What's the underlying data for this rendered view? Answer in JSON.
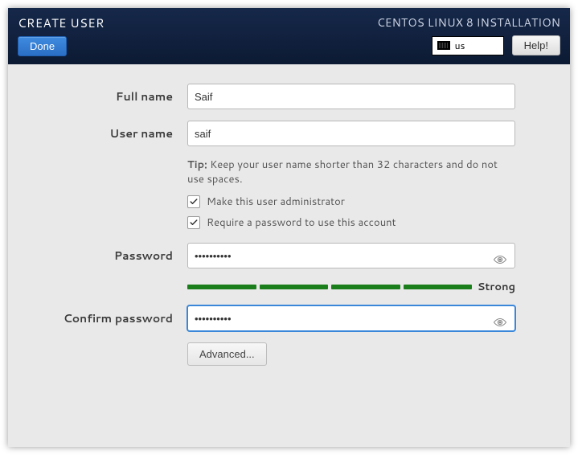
{
  "header": {
    "title": "CREATE USER",
    "subtitle": "CENTOS LINUX 8 INSTALLATION",
    "done_label": "Done",
    "help_label": "Help!",
    "keyboard_layout": "us"
  },
  "form": {
    "full_name_label": "Full name",
    "full_name_value": "Saif",
    "user_name_label": "User name",
    "user_name_value": "saif",
    "tip_prefix": "Tip:",
    "tip_text": "Keep your user name shorter than 32 characters and do not use spaces.",
    "admin_checkbox_label": "Make this user administrator",
    "admin_checked": true,
    "require_pw_checkbox_label": "Require a password to use this account",
    "require_pw_checked": true,
    "password_label": "Password",
    "password_value": "••••••••••",
    "confirm_password_label": "Confirm password",
    "confirm_password_value": "••••••••••",
    "strength_label": "Strong",
    "advanced_label": "Advanced..."
  },
  "colors": {
    "header_bg": "#10213f",
    "accent": "#2a6fc5",
    "strength": "#1a7f1a"
  }
}
